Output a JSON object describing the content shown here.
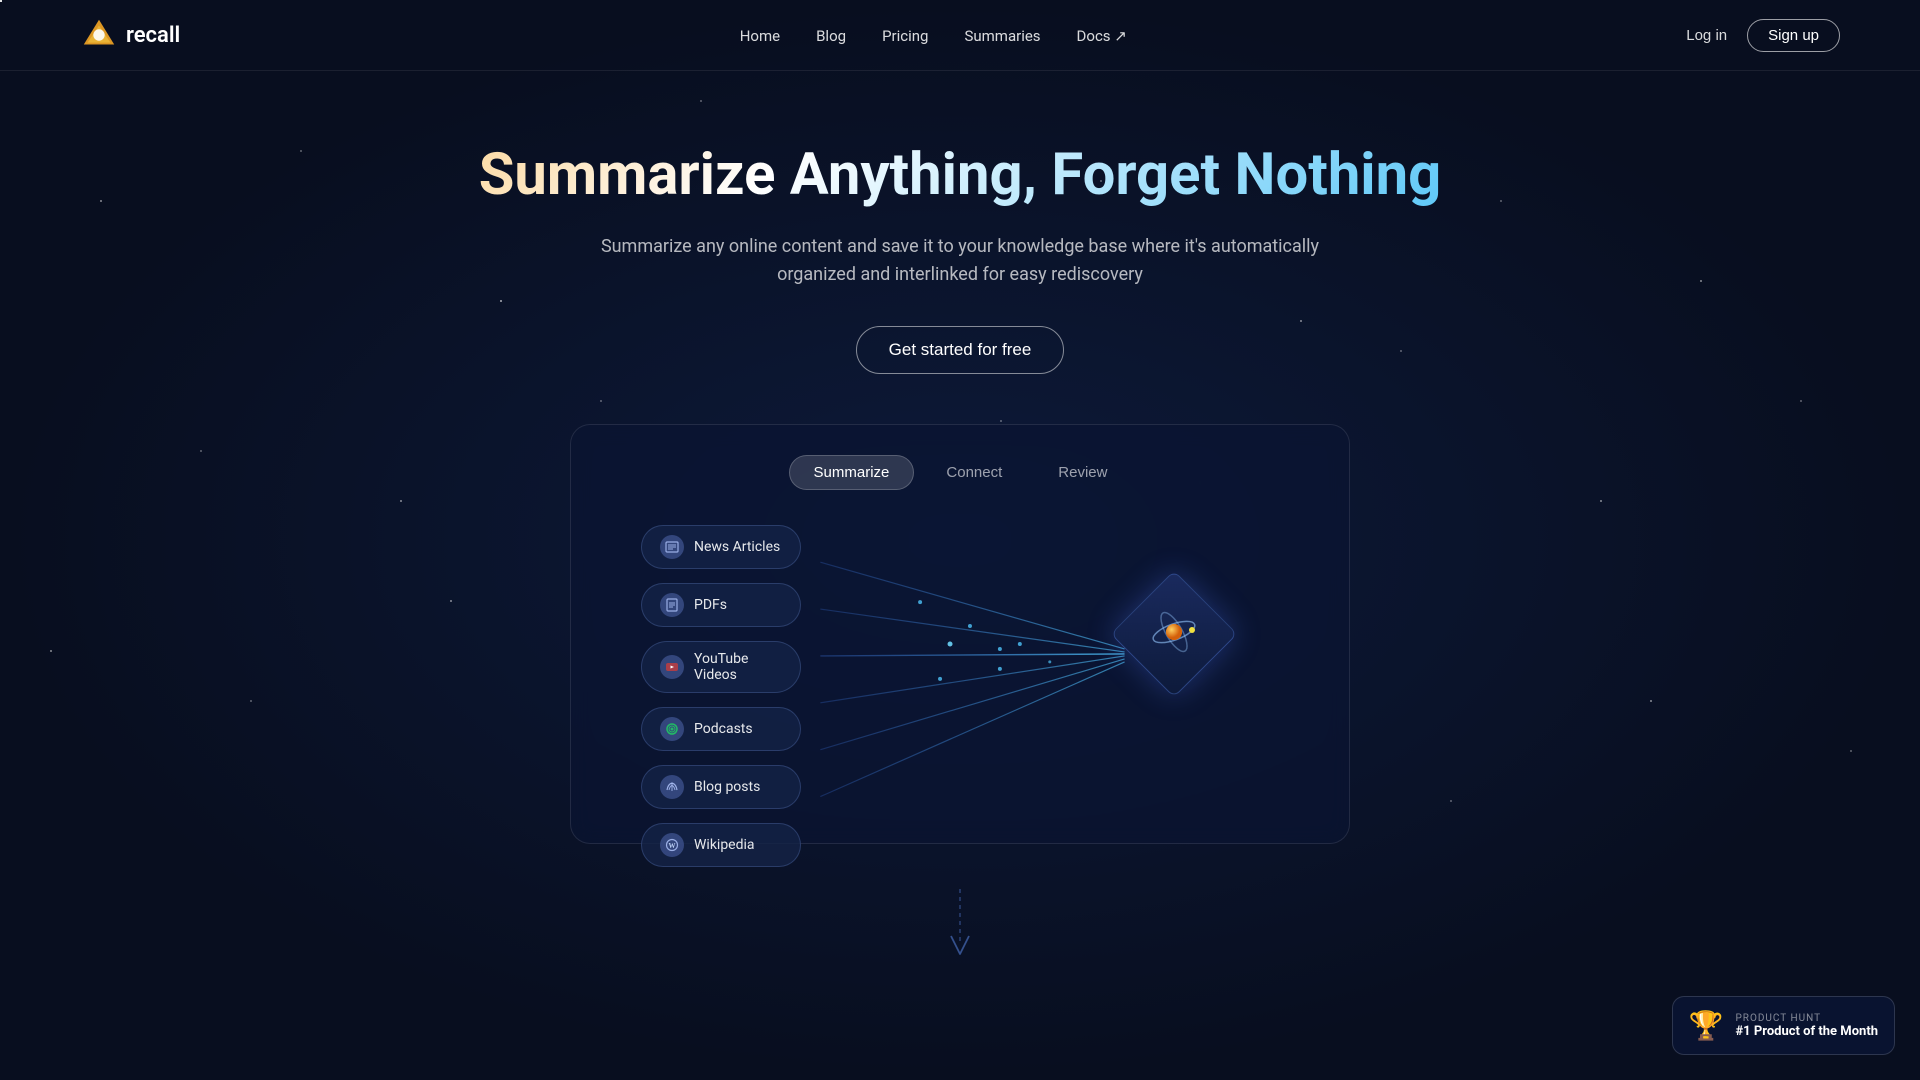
{
  "nav": {
    "logo_text": "recall",
    "links": [
      {
        "label": "Home",
        "href": "#"
      },
      {
        "label": "Blog",
        "href": "#"
      },
      {
        "label": "Pricing",
        "href": "#"
      },
      {
        "label": "Summaries",
        "href": "#"
      },
      {
        "label": "Docs ↗",
        "href": "#"
      }
    ],
    "login_label": "Log in",
    "signup_label": "Sign up"
  },
  "hero": {
    "title": "Summarize Anything, Forget Nothing",
    "subtitle": "Summarize any online content and save it to your knowledge base where it's automatically organized and interlinked for easy rediscovery",
    "cta_label": "Get started for free"
  },
  "demo": {
    "tabs": [
      {
        "label": "Summarize",
        "active": true
      },
      {
        "label": "Connect",
        "active": false
      },
      {
        "label": "Review",
        "active": false
      }
    ],
    "items": [
      {
        "label": "News Articles",
        "icon": "📰"
      },
      {
        "label": "PDFs",
        "icon": "📄"
      },
      {
        "label": "YouTube Videos",
        "icon": "▶"
      },
      {
        "label": "Podcasts",
        "icon": "🎵"
      },
      {
        "label": "Blog posts",
        "icon": "📡"
      },
      {
        "label": "Wikipedia",
        "icon": "W"
      }
    ]
  },
  "product_hunt": {
    "label": "PRODUCT HUNT",
    "title": "#1 Product of the Month",
    "trophy": "🏆"
  }
}
